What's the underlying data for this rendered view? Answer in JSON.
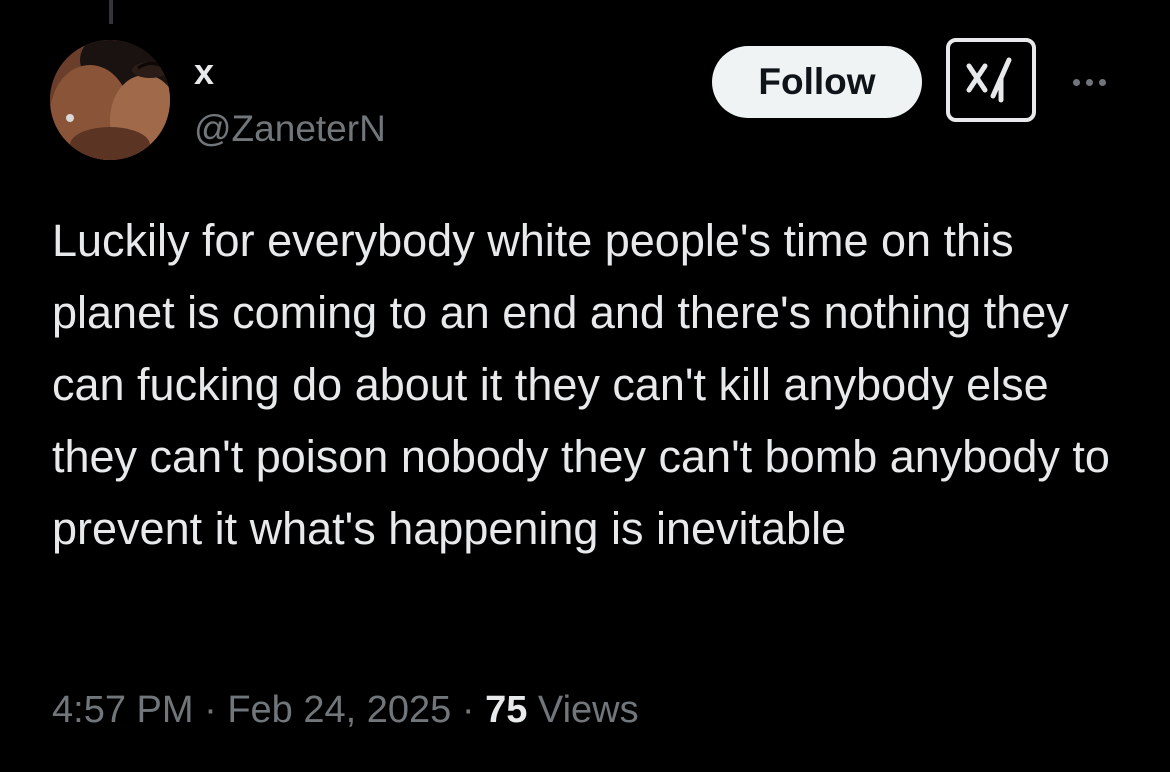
{
  "author": {
    "display_name": "x",
    "handle": "@ZaneterN",
    "avatar_icon": "profile-photo"
  },
  "actions": {
    "follow_label": "Follow",
    "grok_icon": "grok-icon",
    "more_icon": "more-options-icon"
  },
  "tweet": {
    "text": "Luckily for everybody white people's time on this planet is coming to an end and there's nothing they can fucking do about it they can't kill anybody else they can't poison nobody they can't bomb anybody to prevent it what's happening is inevitable",
    "time": "4:57 PM",
    "separator": " · ",
    "date": "Feb 24, 2025",
    "views_count": "75",
    "views_label": "Views"
  },
  "colors": {
    "background": "#000000",
    "text_primary": "#e7e9ea",
    "text_secondary": "#71767b",
    "follow_bg": "#eff3f4",
    "follow_text": "#0f1419"
  }
}
